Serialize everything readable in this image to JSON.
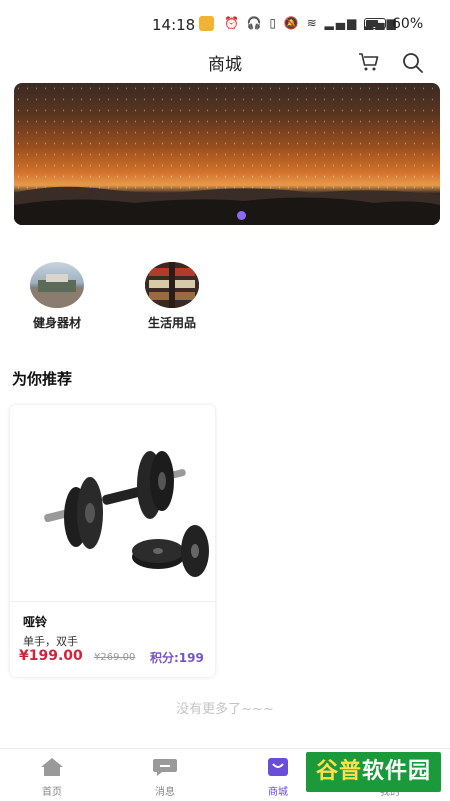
{
  "status_bar": {
    "time": "14:18",
    "battery": "60%",
    "battery_level": 0.6,
    "icons": [
      "alarm-icon",
      "headphones-icon",
      "vibrate-icon",
      "mute-icon",
      "wifi-icon",
      "signal-5g-icon",
      "signal-5g-icon",
      "battery-icon"
    ]
  },
  "header": {
    "title": "商城"
  },
  "banner": {
    "page_indicator_count": 1,
    "active_index": 0,
    "accent": "#8b6cf0"
  },
  "categories": [
    {
      "label": "健身器材"
    },
    {
      "label": "生活用品"
    }
  ],
  "recommend": {
    "title": "为你推荐"
  },
  "products": [
    {
      "name": "哑铃",
      "desc": "单手，双手",
      "price": "¥199.00",
      "old_price": "¥269.00",
      "points": "积分:199"
    }
  ],
  "footer_text": "没有更多了~~~",
  "tabbar": {
    "items": [
      {
        "label": "首页",
        "icon": "home-icon"
      },
      {
        "label": "消息",
        "icon": "message-icon"
      },
      {
        "label": "商城",
        "icon": "shop-bag-icon",
        "active": true
      },
      {
        "label": "我的",
        "icon": "profile-icon"
      }
    ],
    "active_color": "#6b4ed8"
  },
  "watermark": {
    "text_a": "谷普",
    "text_b": "软件园"
  },
  "colors": {
    "price": "#d0243a",
    "points": "#7654c4"
  }
}
